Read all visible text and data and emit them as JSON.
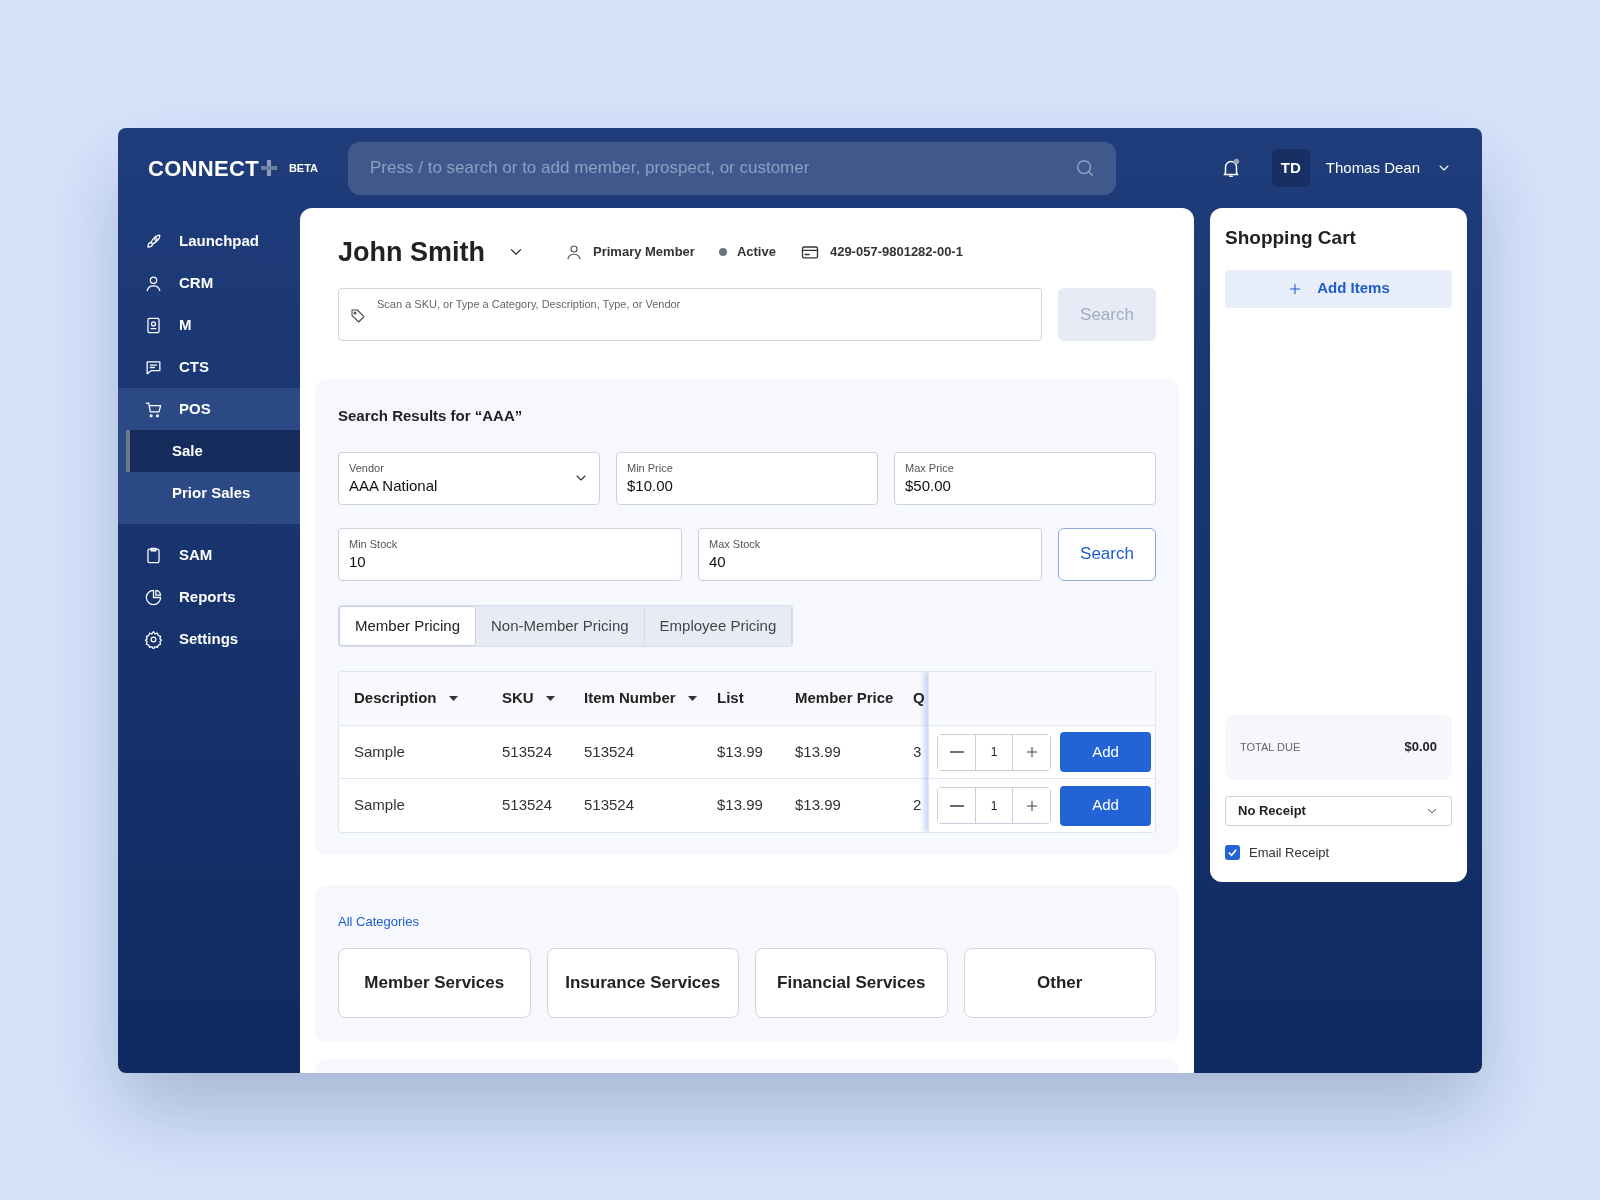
{
  "app": {
    "logo": "CONNECT",
    "badge": "BETA"
  },
  "header": {
    "search_placeholder": "Press / to search or to add member, prospect, or customer",
    "notification": true,
    "user_initials": "TD",
    "user_name": "Thomas Dean"
  },
  "sidebar": {
    "items": [
      {
        "label": "Launchpad",
        "selected": false,
        "expanded": false
      },
      {
        "label": "CRM",
        "selected": false,
        "expanded": false
      },
      {
        "label": "M",
        "selected": false,
        "expanded": false
      },
      {
        "label": "CTS",
        "selected": false,
        "expanded": false
      },
      {
        "label": "POS",
        "selected": false,
        "expanded": true,
        "children": [
          {
            "label": "Sale",
            "selected": true
          },
          {
            "label": "Prior Sales",
            "selected": false
          }
        ]
      },
      {
        "label": "SAM",
        "selected": false,
        "expanded": false
      },
      {
        "label": "Reports",
        "selected": false,
        "expanded": false
      },
      {
        "label": "Settings",
        "selected": false,
        "expanded": false
      }
    ]
  },
  "member": {
    "name": "John Smith",
    "role": "Primary Member",
    "status": "Active",
    "account": "429-057-9801282-00-1"
  },
  "sku_search": {
    "placeholder": "Scan a SKU, or Type a Category, Description, Type, or Vendor",
    "button": "Search",
    "button_disabled": true
  },
  "results": {
    "title": "Search Results for “AAA”",
    "filters": [
      {
        "label": "Vendor",
        "value": "AAA National",
        "kind": "select"
      },
      {
        "label": "Min Price",
        "value": "$10.00",
        "kind": "text"
      },
      {
        "label": "Max Price",
        "value": "$50.00",
        "kind": "text"
      },
      {
        "label": "Min Stock",
        "value": "10",
        "kind": "text"
      },
      {
        "label": "Max Stock",
        "value": "40",
        "kind": "text"
      }
    ],
    "search_button": "Search",
    "tabs": [
      {
        "label": "Member Pricing",
        "selected": true
      },
      {
        "label": "Non-Member Pricing",
        "selected": false
      },
      {
        "label": "Employee Pricing",
        "selected": false
      }
    ],
    "table": {
      "columns": [
        {
          "label": "Description",
          "sortable": true
        },
        {
          "label": "SKU",
          "sortable": true
        },
        {
          "label": "Item Number",
          "sortable": true
        },
        {
          "label": "List",
          "sortable": false
        },
        {
          "label": "Member Price"
        },
        {
          "label": "Q"
        }
      ],
      "rows": [
        {
          "cells": [
            "Sample",
            "513524",
            "513524",
            "$13.99",
            "$13.99",
            "3"
          ],
          "quantity": "1",
          "button": "Add"
        },
        {
          "cells": [
            "Sample",
            "513524",
            "513524",
            "$13.99",
            "$13.99",
            "2"
          ],
          "quantity": "1",
          "button": "Add"
        }
      ]
    }
  },
  "categories": {
    "title": "All Categories",
    "items": [
      "Member Services",
      "Insurance Services",
      "Financial Services",
      "Other"
    ]
  },
  "cart": {
    "title": "Shopping Cart",
    "add_items": "Add Items",
    "total_label": "TOTAL DUE",
    "total": "$0.00",
    "receipt": "No Receipt",
    "email_receipt": {
      "label": "Email Receipt",
      "checked": true
    }
  }
}
